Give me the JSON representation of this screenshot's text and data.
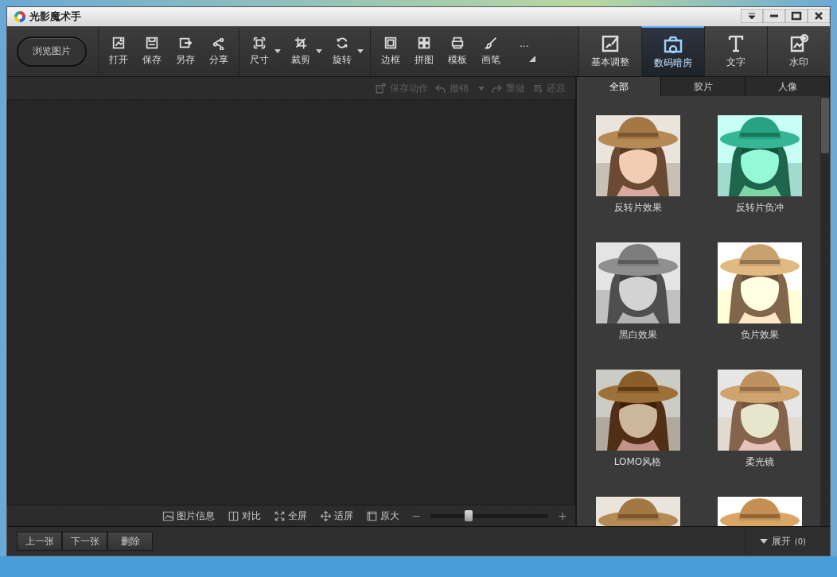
{
  "window": {
    "title": "光影魔术手"
  },
  "toolbar": {
    "browse_button": "浏览图片",
    "groups": [
      [
        {
          "label": "打开",
          "dropdown": false
        },
        {
          "label": "保存",
          "dropdown": false
        },
        {
          "label": "另存",
          "dropdown": false
        },
        {
          "label": "分享",
          "dropdown": false
        }
      ],
      [
        {
          "label": "尺寸",
          "dropdown": true
        },
        {
          "label": "裁剪",
          "dropdown": true
        },
        {
          "label": "旋转",
          "dropdown": true
        }
      ],
      [
        {
          "label": "边框",
          "dropdown": false
        },
        {
          "label": "拼图",
          "dropdown": false
        },
        {
          "label": "模板",
          "dropdown": false
        },
        {
          "label": "画笔",
          "dropdown": false
        }
      ]
    ],
    "more": "···"
  },
  "modes": [
    {
      "label": "基本调整",
      "selected": false
    },
    {
      "label": "数码暗房",
      "selected": true
    },
    {
      "label": "文字",
      "selected": false
    },
    {
      "label": "水印",
      "selected": false
    }
  ],
  "history": [
    {
      "label": "保存动作",
      "dropdown": false,
      "disabled": true
    },
    {
      "label": "撤销",
      "dropdown": true,
      "disabled": true
    },
    {
      "label": "重做",
      "dropdown": false,
      "disabled": true
    },
    {
      "label": "还原",
      "dropdown": false,
      "disabled": true
    }
  ],
  "effect_tabs": [
    {
      "label": "全部",
      "selected": true
    },
    {
      "label": "胶片",
      "selected": false
    },
    {
      "label": "人像",
      "selected": false
    }
  ],
  "effects": [
    {
      "label": "反转片效果",
      "kind": "picture"
    },
    {
      "label": "反转片负冲",
      "kind": "picture"
    },
    {
      "label": "黑白效果",
      "kind": "picture"
    },
    {
      "label": "负片效果",
      "kind": "picture"
    },
    {
      "label": "LOMO风格",
      "kind": "picture"
    },
    {
      "label": "柔光镜",
      "kind": "picture"
    },
    {
      "kind": "picture"
    },
    {
      "kind": "picture"
    }
  ],
  "view_tools": [
    {
      "label": "图片信息"
    },
    {
      "label": "对比"
    },
    {
      "label": "全屏"
    },
    {
      "label": "适屏"
    },
    {
      "label": "原大"
    }
  ],
  "zoom": {
    "minus": "−",
    "plus": "+",
    "level": 0.32
  },
  "footer": {
    "buttons": [
      "上一张",
      "下一张",
      "删除"
    ],
    "expand": "展开",
    "count": "(0)"
  }
}
